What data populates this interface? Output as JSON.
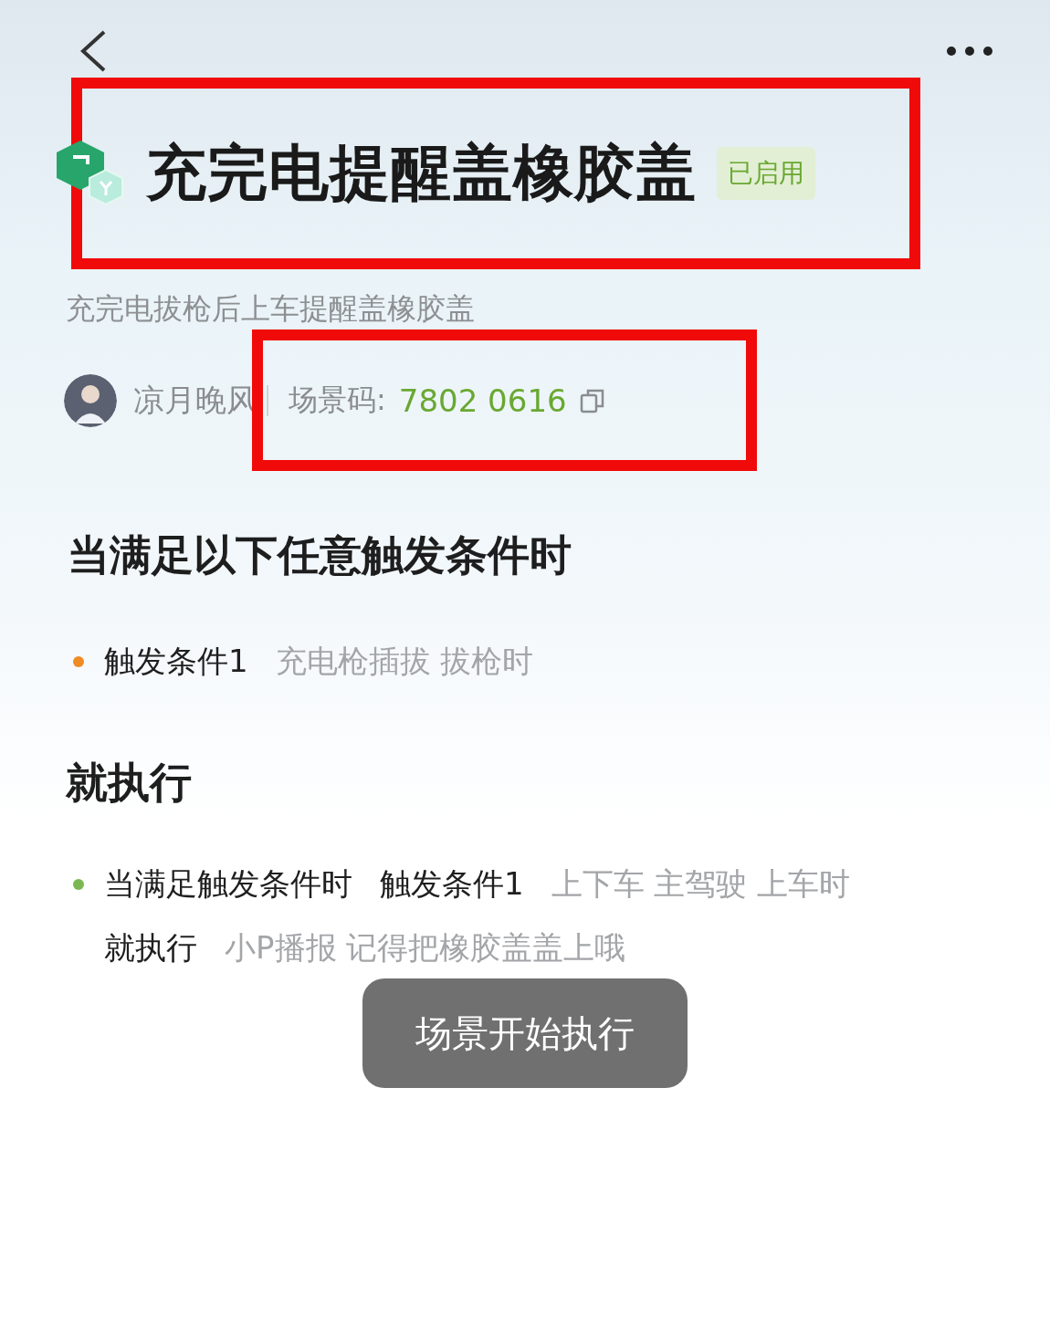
{
  "header": {
    "title": "充完电提醒盖橡胶盖",
    "status_badge": "已启用",
    "highlighted": true
  },
  "description": "充完电拔枪后上车提醒盖橡胶盖",
  "meta": {
    "author": "凉月晚风",
    "scene_code_label": "场景码:",
    "scene_code": "7802 0616",
    "highlighted": true
  },
  "triggers": {
    "heading": "当满足以下任意触发条件时",
    "items": [
      {
        "color": "#f08a24",
        "parts": [
          {
            "kind": "label",
            "text": "触发条件1"
          },
          {
            "kind": "value",
            "text": "充电枪插拔 拔枪时"
          }
        ]
      }
    ]
  },
  "actions": {
    "heading": "就执行",
    "items": [
      {
        "color": "#7cb851",
        "lines": [
          [
            {
              "kind": "label",
              "text": "当满足触发条件时"
            },
            {
              "kind": "label",
              "text": "触发条件1"
            },
            {
              "kind": "value",
              "text": "上下车 主驾驶 上车时"
            }
          ],
          [
            {
              "kind": "label",
              "text": "就执行"
            },
            {
              "kind": "value",
              "text": "小P播报 记得把橡胶盖盖上哦"
            }
          ]
        ]
      }
    ]
  },
  "toast": "场景开始执行"
}
